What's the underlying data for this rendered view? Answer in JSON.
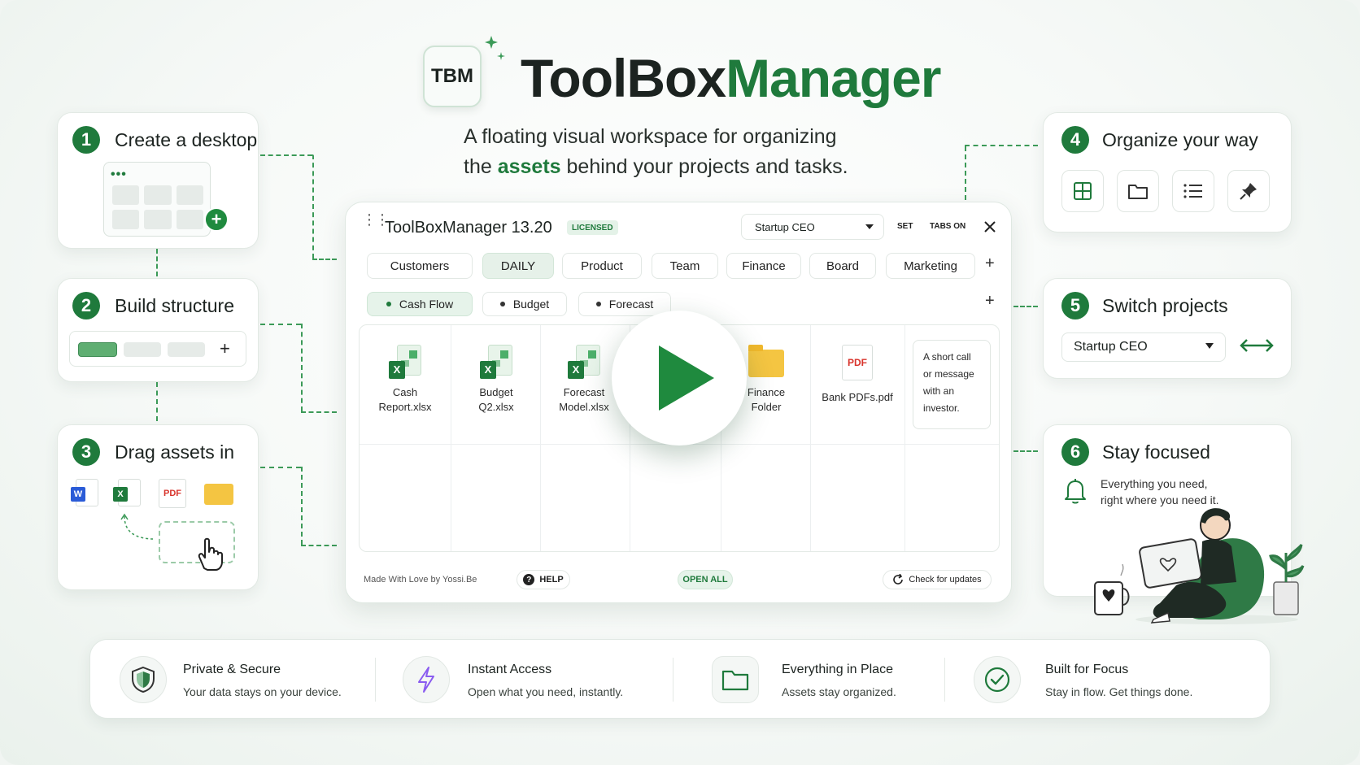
{
  "brand": {
    "logo": "TBM",
    "name_part1": "ToolBox",
    "name_part2": "Manager"
  },
  "tagline": {
    "line1": "A floating visual workspace for organizing",
    "line2_pre": "the ",
    "line2_hl": "assets",
    "line2_post": " behind your projects and tasks."
  },
  "steps": [
    {
      "num": "1",
      "title": "Create a desktop"
    },
    {
      "num": "2",
      "title": "Build structure"
    },
    {
      "num": "3",
      "title": "Drag assets in"
    },
    {
      "num": "4",
      "title": "Organize your way"
    },
    {
      "num": "5",
      "title": "Switch projects"
    },
    {
      "num": "6",
      "title": "Stay focused"
    }
  ],
  "step3": {
    "pdf_label": "PDF",
    "word_label": "W",
    "excel_label": "X"
  },
  "step5": {
    "project_select": "Startup CEO"
  },
  "step6": {
    "line1": "Everything you need,",
    "line2": "right where you need it."
  },
  "window": {
    "title": "ToolBoxManager 13.20",
    "license_badge": "LICENSED",
    "project_select": "Startup CEO",
    "set_label": "SET",
    "tabs_on_label": "TABS ON",
    "tabs": [
      "Customers",
      "DAILY",
      "Product",
      "Team",
      "Finance",
      "Board",
      "Marketing"
    ],
    "subtabs": [
      "Cash Flow",
      "Budget",
      "Forecast"
    ],
    "assets": [
      {
        "line1": "Cash",
        "line2": "Report.xlsx"
      },
      {
        "line1": "Budget",
        "line2": "Q2.xlsx"
      },
      {
        "line1": "Forecast",
        "line2": "Model.xlsx"
      },
      {
        "line1": "Finance",
        "line2": "Folder"
      },
      {
        "line1": "Bank PDFs.pdf",
        "line2": ""
      }
    ],
    "pdf_icon_label": "PDF",
    "note": {
      "line1": "A short call",
      "line2": "or message",
      "line3": "with an",
      "line4": "investor."
    },
    "footer": {
      "credit": "Made With Love by Yossi.Be",
      "help": "HELP",
      "open_all": "OPEN ALL",
      "updates": "Check for updates"
    }
  },
  "features": [
    {
      "title": "Private & Secure",
      "desc": "Your data stays on your device."
    },
    {
      "title": "Instant Access",
      "desc": "Open what you need, instantly."
    },
    {
      "title": "Everything in Place",
      "desc": "Assets stay organized."
    },
    {
      "title": "Built for Focus",
      "desc": "Stay in flow. Get things done."
    }
  ],
  "colors": {
    "accent": "#1f7a3c",
    "accent_light": "#e6f1e9",
    "pdf_red": "#d8332b",
    "word_blue": "#2a5bd7",
    "folder_yellow": "#f4c542",
    "bolt_purple": "#8a5cf0"
  }
}
